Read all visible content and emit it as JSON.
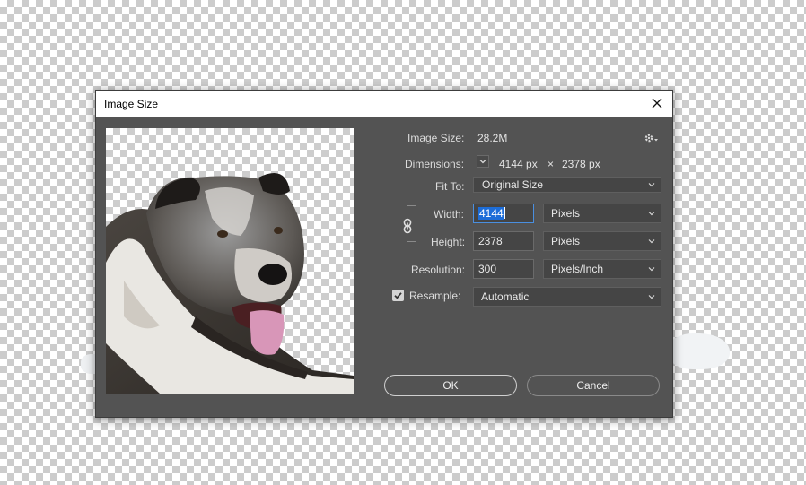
{
  "dialog": {
    "title": "Image Size"
  },
  "info": {
    "image_size_label": "Image Size:",
    "image_size_value": "28.2M",
    "dimensions_label": "Dimensions:",
    "dim_width": "4144 px",
    "dim_times": "×",
    "dim_height": "2378 px"
  },
  "fit_to": {
    "label": "Fit To:",
    "value": "Original Size"
  },
  "width": {
    "label": "Width:",
    "value": "4144",
    "unit": "Pixels"
  },
  "height": {
    "label": "Height:",
    "value": "2378",
    "unit": "Pixels"
  },
  "resolution": {
    "label": "Resolution:",
    "value": "300",
    "unit": "Pixels/Inch"
  },
  "resample": {
    "label": "Resample:",
    "checked": true,
    "value": "Automatic"
  },
  "buttons": {
    "ok": "OK",
    "cancel": "Cancel"
  },
  "colors": {
    "dialog_bg": "#535353",
    "field_bg": "#454545",
    "focus": "#4a8fe0",
    "selection": "#1d6dd8"
  },
  "icons": {
    "close": "close-icon",
    "settings": "gear-icon",
    "constrain": "chain-link-icon",
    "dimensions_toggle": "chevron-down-icon"
  }
}
